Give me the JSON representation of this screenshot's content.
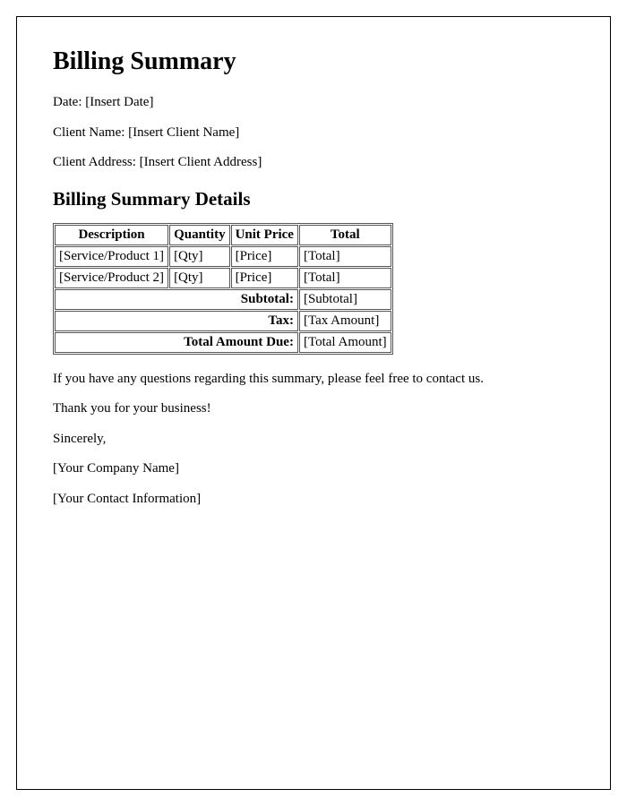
{
  "title": "Billing Summary",
  "meta": {
    "date_label": "Date: ",
    "date_value": "[Insert Date]",
    "client_name_label": "Client Name: ",
    "client_name_value": "[Insert Client Name]",
    "client_address_label": "Client Address: ",
    "client_address_value": "[Insert Client Address]"
  },
  "details_heading": "Billing Summary Details",
  "table": {
    "headers": {
      "description": "Description",
      "quantity": "Quantity",
      "unit_price": "Unit Price",
      "total": "Total"
    },
    "rows": [
      {
        "description": "[Service/Product 1]",
        "quantity": "[Qty]",
        "unit_price": "[Price]",
        "total": "[Total]"
      },
      {
        "description": "[Service/Product 2]",
        "quantity": "[Qty]",
        "unit_price": "[Price]",
        "total": "[Total]"
      }
    ],
    "summary": {
      "subtotal_label": "Subtotal:",
      "subtotal_value": "[Subtotal]",
      "tax_label": "Tax:",
      "tax_value": "[Tax Amount]",
      "total_due_label": "Total Amount Due:",
      "total_due_value": "[Total Amount]"
    }
  },
  "footer": {
    "questions": "If you have any questions regarding this summary, please feel free to contact us.",
    "thanks": "Thank you for your business!",
    "signoff": "Sincerely,",
    "company": "[Your Company Name]",
    "contact": "[Your Contact Information]"
  }
}
